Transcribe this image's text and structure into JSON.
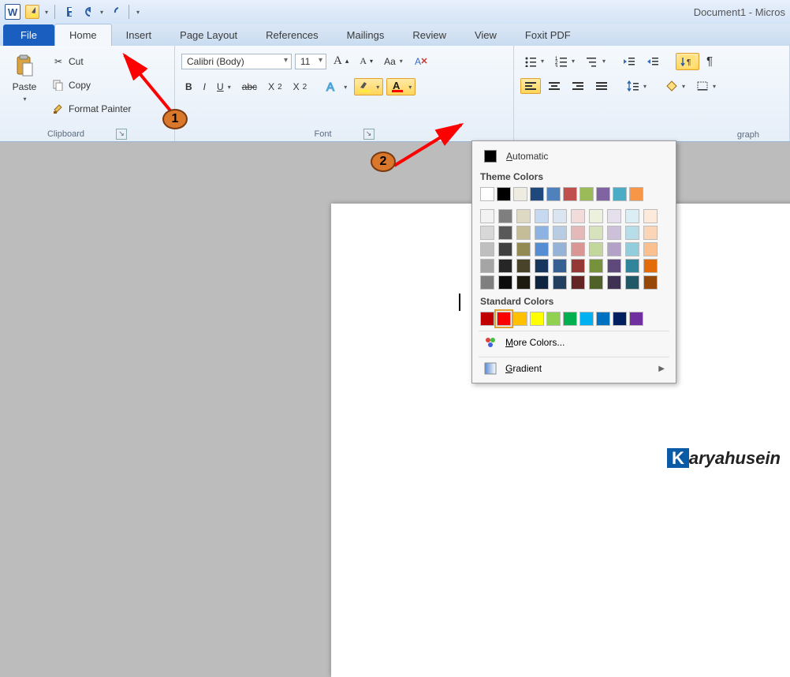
{
  "window": {
    "title": "Document1 - Micros"
  },
  "tabs": {
    "file": "File",
    "items": [
      "Home",
      "Insert",
      "Page Layout",
      "References",
      "Mailings",
      "Review",
      "View",
      "Foxit PDF"
    ],
    "active": 0
  },
  "clipboard": {
    "paste": "Paste",
    "cut": "Cut",
    "copy": "Copy",
    "format_painter": "Format Painter",
    "label": "Clipboard"
  },
  "font": {
    "name": "Calibri (Body)",
    "size": "11",
    "label": "Font"
  },
  "paragraph": {
    "label": "graph"
  },
  "font_color_popup": {
    "automatic": "Automatic",
    "theme_title": "Theme Colors",
    "standard_title": "Standard Colors",
    "more": "More Colors...",
    "gradient": "Gradient",
    "theme_row1": [
      "#ffffff",
      "#000000",
      "#eeece1",
      "#1f497d",
      "#4f81bd",
      "#c0504d",
      "#9bbb59",
      "#8064a2",
      "#4bacc6",
      "#f79646"
    ],
    "theme_shades": [
      [
        "#f2f2f2",
        "#7f7f7f",
        "#ddd9c3",
        "#c6d9f0",
        "#dbe5f1",
        "#f2dcdb",
        "#ebf1dd",
        "#e5e0ec",
        "#dbeef3",
        "#fdeada"
      ],
      [
        "#d8d8d8",
        "#595959",
        "#c4bd97",
        "#8db3e2",
        "#b8cce4",
        "#e5b9b7",
        "#d7e3bc",
        "#ccc1d9",
        "#b7dde8",
        "#fbd5b5"
      ],
      [
        "#bfbfbf",
        "#3f3f3f",
        "#938953",
        "#548dd4",
        "#95b3d7",
        "#d99694",
        "#c3d69b",
        "#b2a2c7",
        "#92cddc",
        "#fac08f"
      ],
      [
        "#a5a5a5",
        "#262626",
        "#494429",
        "#17365d",
        "#366092",
        "#953734",
        "#76923c",
        "#5f497a",
        "#31859b",
        "#e36c09"
      ],
      [
        "#7f7f7f",
        "#0c0c0c",
        "#1d1b10",
        "#0f243e",
        "#244061",
        "#632423",
        "#4f6128",
        "#3f3151",
        "#205867",
        "#974806"
      ]
    ],
    "standard": [
      "#c00000",
      "#ff0000",
      "#ffc000",
      "#ffff00",
      "#92d050",
      "#00b050",
      "#00b0f0",
      "#0070c0",
      "#002060",
      "#7030a0"
    ],
    "standard_selected_index": 1
  },
  "annotations": {
    "badge1": "1",
    "badge2": "2"
  },
  "watermark": {
    "k": "K",
    "rest": "aryahusein"
  }
}
